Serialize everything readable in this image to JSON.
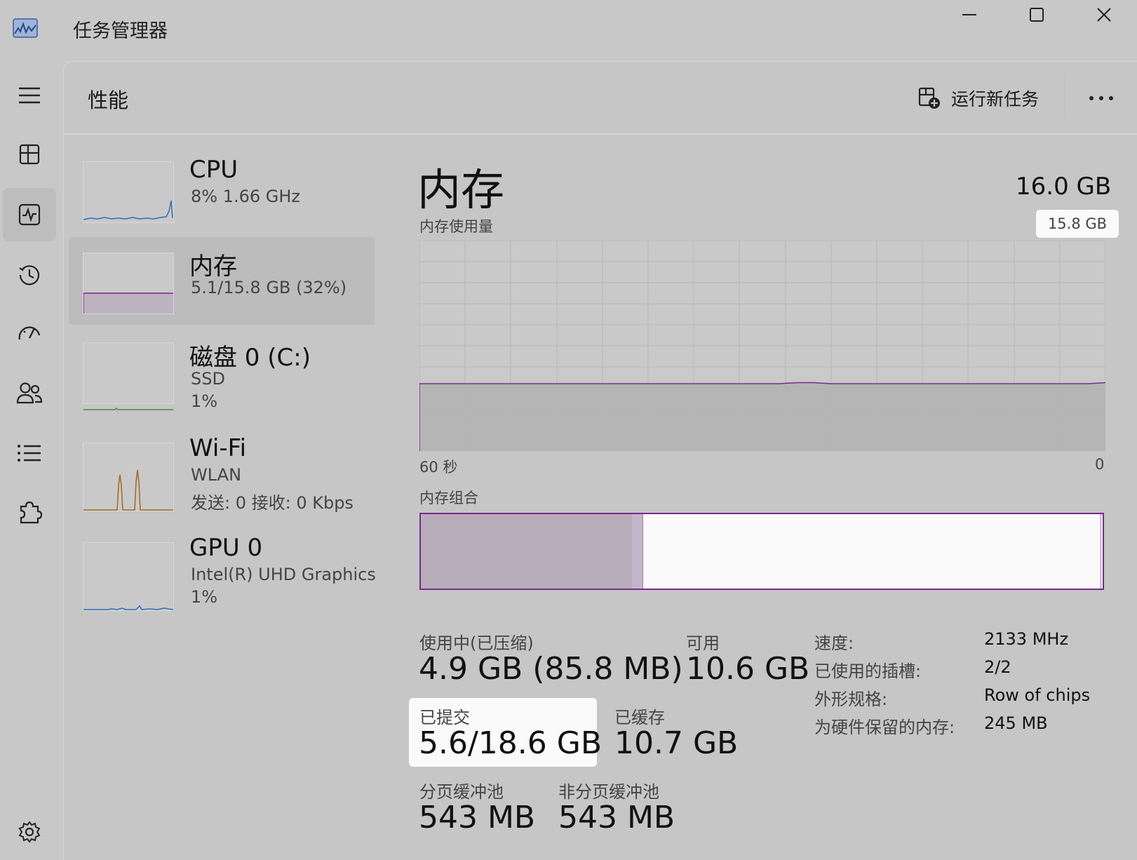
{
  "window": {
    "title": "任务管理器",
    "controls": [
      "minimize-icon",
      "maximize-icon",
      "close-icon"
    ]
  },
  "sidebar": {
    "items": [
      {
        "name": "hamburger-menu",
        "icon": "hamburger-icon"
      },
      {
        "name": "processes",
        "icon": "processes-grid-icon"
      },
      {
        "name": "performance",
        "icon": "performance-pulse-icon",
        "active": true
      },
      {
        "name": "app-history",
        "icon": "history-clock-icon"
      },
      {
        "name": "startup-apps",
        "icon": "startup-speedometer-icon"
      },
      {
        "name": "users",
        "icon": "users-icon"
      },
      {
        "name": "details",
        "icon": "details-list-icon"
      },
      {
        "name": "services",
        "icon": "services-puzzle-icon"
      }
    ],
    "settings_icon": "gear-icon"
  },
  "header": {
    "title": "性能",
    "run_task_label": "运行新任务",
    "more_icon": "more-ellipsis-icon"
  },
  "devices": [
    {
      "name": "CPU",
      "line1": "8% 1.66 GHz",
      "line2": "",
      "color": "#2f6fb5"
    },
    {
      "name": "内存",
      "line1": "5.1/15.8 GB (32%)",
      "line2": "",
      "color": "#7a2a8c",
      "selected": true
    },
    {
      "name": "磁盘 0 (C:)",
      "line1": "SSD",
      "line2": "1%",
      "color": "#4e8a3a"
    },
    {
      "name": "Wi-Fi",
      "line1": "WLAN",
      "line2": "发送: 0 接收: 0 Kbps",
      "color": "#a06a1c"
    },
    {
      "name": "GPU 0",
      "line1": "Intel(R) UHD Graphics",
      "line2": "1%",
      "color": "#2f6fb5"
    }
  ],
  "memory": {
    "title": "内存",
    "total": "16.0 GB",
    "usage_label": "内存使用量",
    "usage_max": "15.8 GB",
    "x_left": "60 秒",
    "x_right": "0",
    "composition_label": "内存组合",
    "usage_fraction": 0.32,
    "composition": {
      "in_use_fraction": 0.31,
      "modified_fraction": 0.015
    },
    "accent": "#7a2a8c",
    "stats": {
      "in_use_label": "使用中(已压缩)",
      "in_use_value": "4.9 GB (85.8 MB)",
      "available_label": "可用",
      "available_value": "10.6 GB",
      "committed_label": "已提交",
      "committed_value": "5.6/18.6 GB",
      "cached_label": "已缓存",
      "cached_value": "10.7 GB",
      "paged_label": "分页缓冲池",
      "paged_value": "543 MB",
      "nonpaged_label": "非分页缓冲池",
      "nonpaged_value": "543 MB"
    },
    "props": [
      {
        "label": "速度:",
        "value": "2133 MHz"
      },
      {
        "label": "已使用的插槽:",
        "value": "2/2"
      },
      {
        "label": "外形规格:",
        "value": "Row of chips"
      },
      {
        "label": "为硬件保留的内存:",
        "value": "245 MB"
      }
    ]
  }
}
